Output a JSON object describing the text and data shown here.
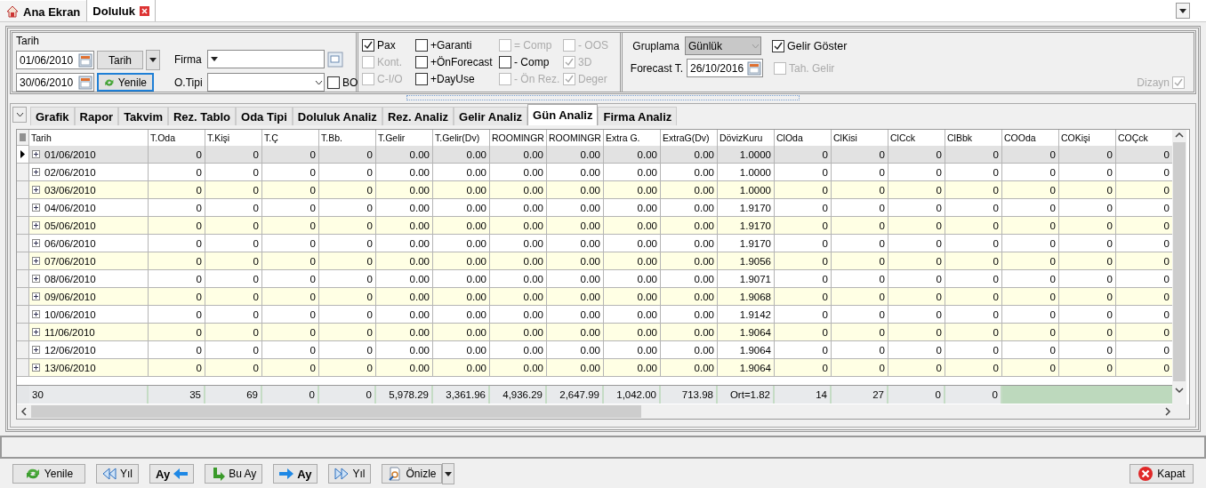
{
  "tabs": [
    {
      "label": "Ana Ekran",
      "selected": false
    },
    {
      "label": "Doluluk",
      "selected": true
    }
  ],
  "filters": {
    "date_label": "Tarih",
    "start_date": "01/06/2010",
    "end_date": "30/06/2010",
    "date_type": "Tarih",
    "refresh_label": "Yenile",
    "firma_label": "Firma",
    "otipi_label": "O.Tipi",
    "bo": {
      "label": "BO",
      "checked": false
    }
  },
  "options": [
    {
      "label": "Pax",
      "checked": true,
      "disabled": false
    },
    {
      "label": "+Garanti",
      "checked": false,
      "disabled": false
    },
    {
      "label": "= Comp",
      "checked": false,
      "disabled": true
    },
    {
      "label": "- OOS",
      "checked": false,
      "disabled": true
    },
    {
      "label": "Kont.",
      "checked": false,
      "disabled": true
    },
    {
      "label": "+ÖnForecast",
      "checked": false,
      "disabled": false
    },
    {
      "label": "- Comp",
      "checked": false,
      "disabled": false
    },
    {
      "label": "3D",
      "checked": true,
      "disabled": true
    },
    {
      "label": "C-I/O",
      "checked": false,
      "disabled": true
    },
    {
      "label": "+DayUse",
      "checked": false,
      "disabled": false
    },
    {
      "label": "- Ön Rez.",
      "checked": false,
      "disabled": true
    },
    {
      "label": "Deger",
      "checked": true,
      "disabled": true
    }
  ],
  "grouping": {
    "label": "Gruplama",
    "value": "Günlük",
    "forecast_label": "Forecast T.",
    "forecast_date": "26/10/2016",
    "show_income": {
      "label": "Gelir Göster",
      "checked": true,
      "disabled": false
    },
    "collection": {
      "label": "Tah. Gelir",
      "checked": false,
      "disabled": true
    },
    "design": {
      "label": "Dizayn",
      "checked": true,
      "disabled": true
    }
  },
  "view_tabs": [
    {
      "label": "Grafik",
      "selected": false
    },
    {
      "label": "Rapor",
      "selected": false
    },
    {
      "label": "Takvim",
      "selected": false
    },
    {
      "label": "Rez. Tablo",
      "selected": false
    },
    {
      "label": "Oda Tipi",
      "selected": false
    },
    {
      "label": "Doluluk Analiz",
      "selected": false
    },
    {
      "label": "Rez. Analiz",
      "selected": false
    },
    {
      "label": "Gelir Analiz",
      "selected": false
    },
    {
      "label": "Gün Analiz",
      "selected": true
    },
    {
      "label": "Firma Analiz",
      "selected": false
    }
  ],
  "table": {
    "columns": [
      "Tarih",
      "T.Oda",
      "T.Kişi",
      "T.Ç",
      "T.Bb.",
      "T.Gelir",
      "T.Gelir(Dv)",
      "ROOMINGR",
      "ROOMINGR",
      "Extra G.",
      "ExtraG(Dv)",
      "DövizKuru",
      "ClOda",
      "ClKisi",
      "ClCck",
      "ClBbk",
      "COOda",
      "COKişi",
      "COÇck"
    ],
    "rows": [
      {
        "selected": true,
        "cells": [
          "01/06/2010",
          "0",
          "0",
          "0",
          "0",
          "0.00",
          "0.00",
          "0.00",
          "0.00",
          "0.00",
          "0.00",
          "1.0000",
          "0",
          "0",
          "0",
          "0",
          "0",
          "0",
          "0"
        ]
      },
      {
        "selected": false,
        "cells": [
          "02/06/2010",
          "0",
          "0",
          "0",
          "0",
          "0.00",
          "0.00",
          "0.00",
          "0.00",
          "0.00",
          "0.00",
          "1.0000",
          "0",
          "0",
          "0",
          "0",
          "0",
          "0",
          "0"
        ]
      },
      {
        "selected": false,
        "cells": [
          "03/06/2010",
          "0",
          "0",
          "0",
          "0",
          "0.00",
          "0.00",
          "0.00",
          "0.00",
          "0.00",
          "0.00",
          "1.0000",
          "0",
          "0",
          "0",
          "0",
          "0",
          "0",
          "0"
        ]
      },
      {
        "selected": false,
        "cells": [
          "04/06/2010",
          "0",
          "0",
          "0",
          "0",
          "0.00",
          "0.00",
          "0.00",
          "0.00",
          "0.00",
          "0.00",
          "1.9170",
          "0",
          "0",
          "0",
          "0",
          "0",
          "0",
          "0"
        ]
      },
      {
        "selected": false,
        "cells": [
          "05/06/2010",
          "0",
          "0",
          "0",
          "0",
          "0.00",
          "0.00",
          "0.00",
          "0.00",
          "0.00",
          "0.00",
          "1.9170",
          "0",
          "0",
          "0",
          "0",
          "0",
          "0",
          "0"
        ]
      },
      {
        "selected": false,
        "cells": [
          "06/06/2010",
          "0",
          "0",
          "0",
          "0",
          "0.00",
          "0.00",
          "0.00",
          "0.00",
          "0.00",
          "0.00",
          "1.9170",
          "0",
          "0",
          "0",
          "0",
          "0",
          "0",
          "0"
        ]
      },
      {
        "selected": false,
        "cells": [
          "07/06/2010",
          "0",
          "0",
          "0",
          "0",
          "0.00",
          "0.00",
          "0.00",
          "0.00",
          "0.00",
          "0.00",
          "1.9056",
          "0",
          "0",
          "0",
          "0",
          "0",
          "0",
          "0"
        ]
      },
      {
        "selected": false,
        "cells": [
          "08/06/2010",
          "0",
          "0",
          "0",
          "0",
          "0.00",
          "0.00",
          "0.00",
          "0.00",
          "0.00",
          "0.00",
          "1.9071",
          "0",
          "0",
          "0",
          "0",
          "0",
          "0",
          "0"
        ]
      },
      {
        "selected": false,
        "cells": [
          "09/06/2010",
          "0",
          "0",
          "0",
          "0",
          "0.00",
          "0.00",
          "0.00",
          "0.00",
          "0.00",
          "0.00",
          "1.9068",
          "0",
          "0",
          "0",
          "0",
          "0",
          "0",
          "0"
        ]
      },
      {
        "selected": false,
        "cells": [
          "10/06/2010",
          "0",
          "0",
          "0",
          "0",
          "0.00",
          "0.00",
          "0.00",
          "0.00",
          "0.00",
          "0.00",
          "1.9142",
          "0",
          "0",
          "0",
          "0",
          "0",
          "0",
          "0"
        ]
      },
      {
        "selected": false,
        "cells": [
          "11/06/2010",
          "0",
          "0",
          "0",
          "0",
          "0.00",
          "0.00",
          "0.00",
          "0.00",
          "0.00",
          "0.00",
          "1.9064",
          "0",
          "0",
          "0",
          "0",
          "0",
          "0",
          "0"
        ]
      },
      {
        "selected": false,
        "cells": [
          "12/06/2010",
          "0",
          "0",
          "0",
          "0",
          "0.00",
          "0.00",
          "0.00",
          "0.00",
          "0.00",
          "0.00",
          "1.9064",
          "0",
          "0",
          "0",
          "0",
          "0",
          "0",
          "0"
        ]
      },
      {
        "selected": false,
        "cells": [
          "13/06/2010",
          "0",
          "0",
          "0",
          "0",
          "0.00",
          "0.00",
          "0.00",
          "0.00",
          "0.00",
          "0.00",
          "1.9064",
          "0",
          "0",
          "0",
          "0",
          "0",
          "0",
          "0"
        ]
      }
    ],
    "footer": [
      "30",
      "35",
      "69",
      "0",
      "0",
      "5,978.29",
      "3,361.96",
      "4,936.29",
      "2,647.99",
      "1,042.00",
      "713.98",
      "Ort=1.82",
      "14",
      "27",
      "0",
      "0"
    ]
  },
  "toolbar": [
    {
      "label": "Yenile",
      "bold": false
    },
    {
      "label": "Yıl",
      "bold": false
    },
    {
      "label": "Ay",
      "bold": true
    },
    {
      "label": "Bu Ay",
      "bold": false
    },
    {
      "label": "Ay",
      "bold": true
    },
    {
      "label": "Yıl",
      "bold": false
    },
    {
      "label": "Önizle",
      "bold": false
    }
  ],
  "close_label": "Kapat"
}
